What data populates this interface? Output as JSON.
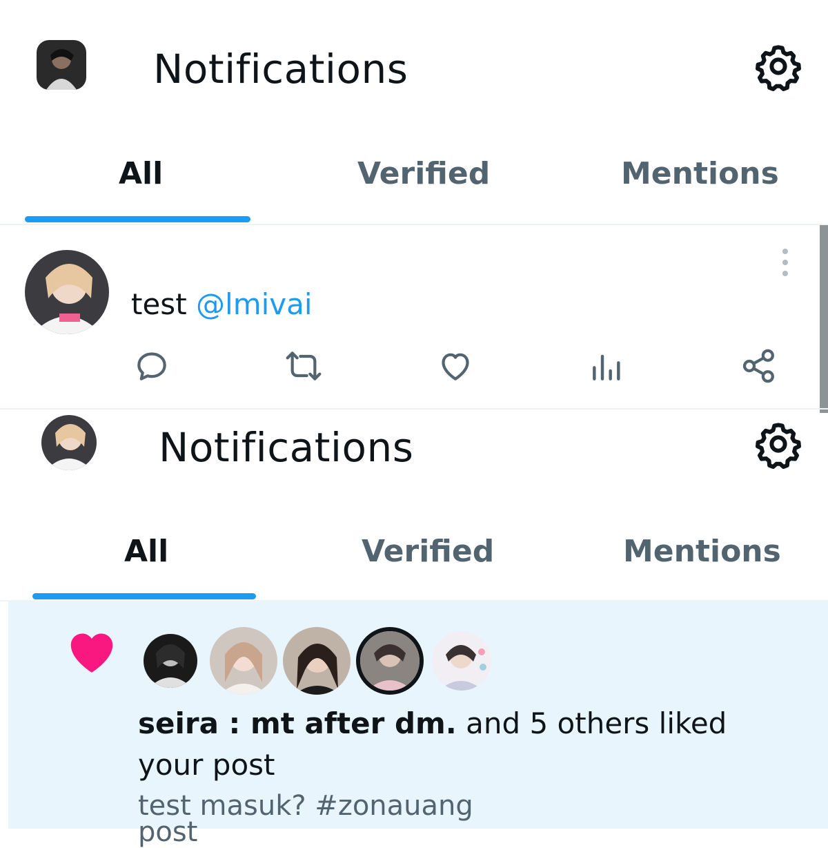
{
  "screen1": {
    "header": {
      "title": "Notifications"
    },
    "tabs": [
      {
        "label": "All",
        "active": true
      },
      {
        "label": "Verified",
        "active": false
      },
      {
        "label": "Mentions",
        "active": false
      }
    ],
    "tweet": {
      "text": "test",
      "mention": "@lmivai"
    },
    "actions": [
      "reply-icon",
      "retweet-icon",
      "like-icon",
      "views-icon",
      "share-icon"
    ]
  },
  "screen2": {
    "header": {
      "title": "Notifications"
    },
    "tabs": [
      {
        "label": "All",
        "active": true
      },
      {
        "label": "Verified",
        "active": false
      },
      {
        "label": "Mentions",
        "active": false
      }
    ],
    "notification": {
      "type_icon": "heart-icon",
      "names": "seira : mt after dm.",
      "rest": "and 5 others liked your post",
      "post_preview": "test masuk? #zonauang",
      "post_preview_cut": "post"
    }
  },
  "colors": {
    "accent": "#1d9bf0",
    "like": "#f91880",
    "text": "#0f1419",
    "muted": "#536471",
    "highlight_bg": "#e8f5fd"
  }
}
